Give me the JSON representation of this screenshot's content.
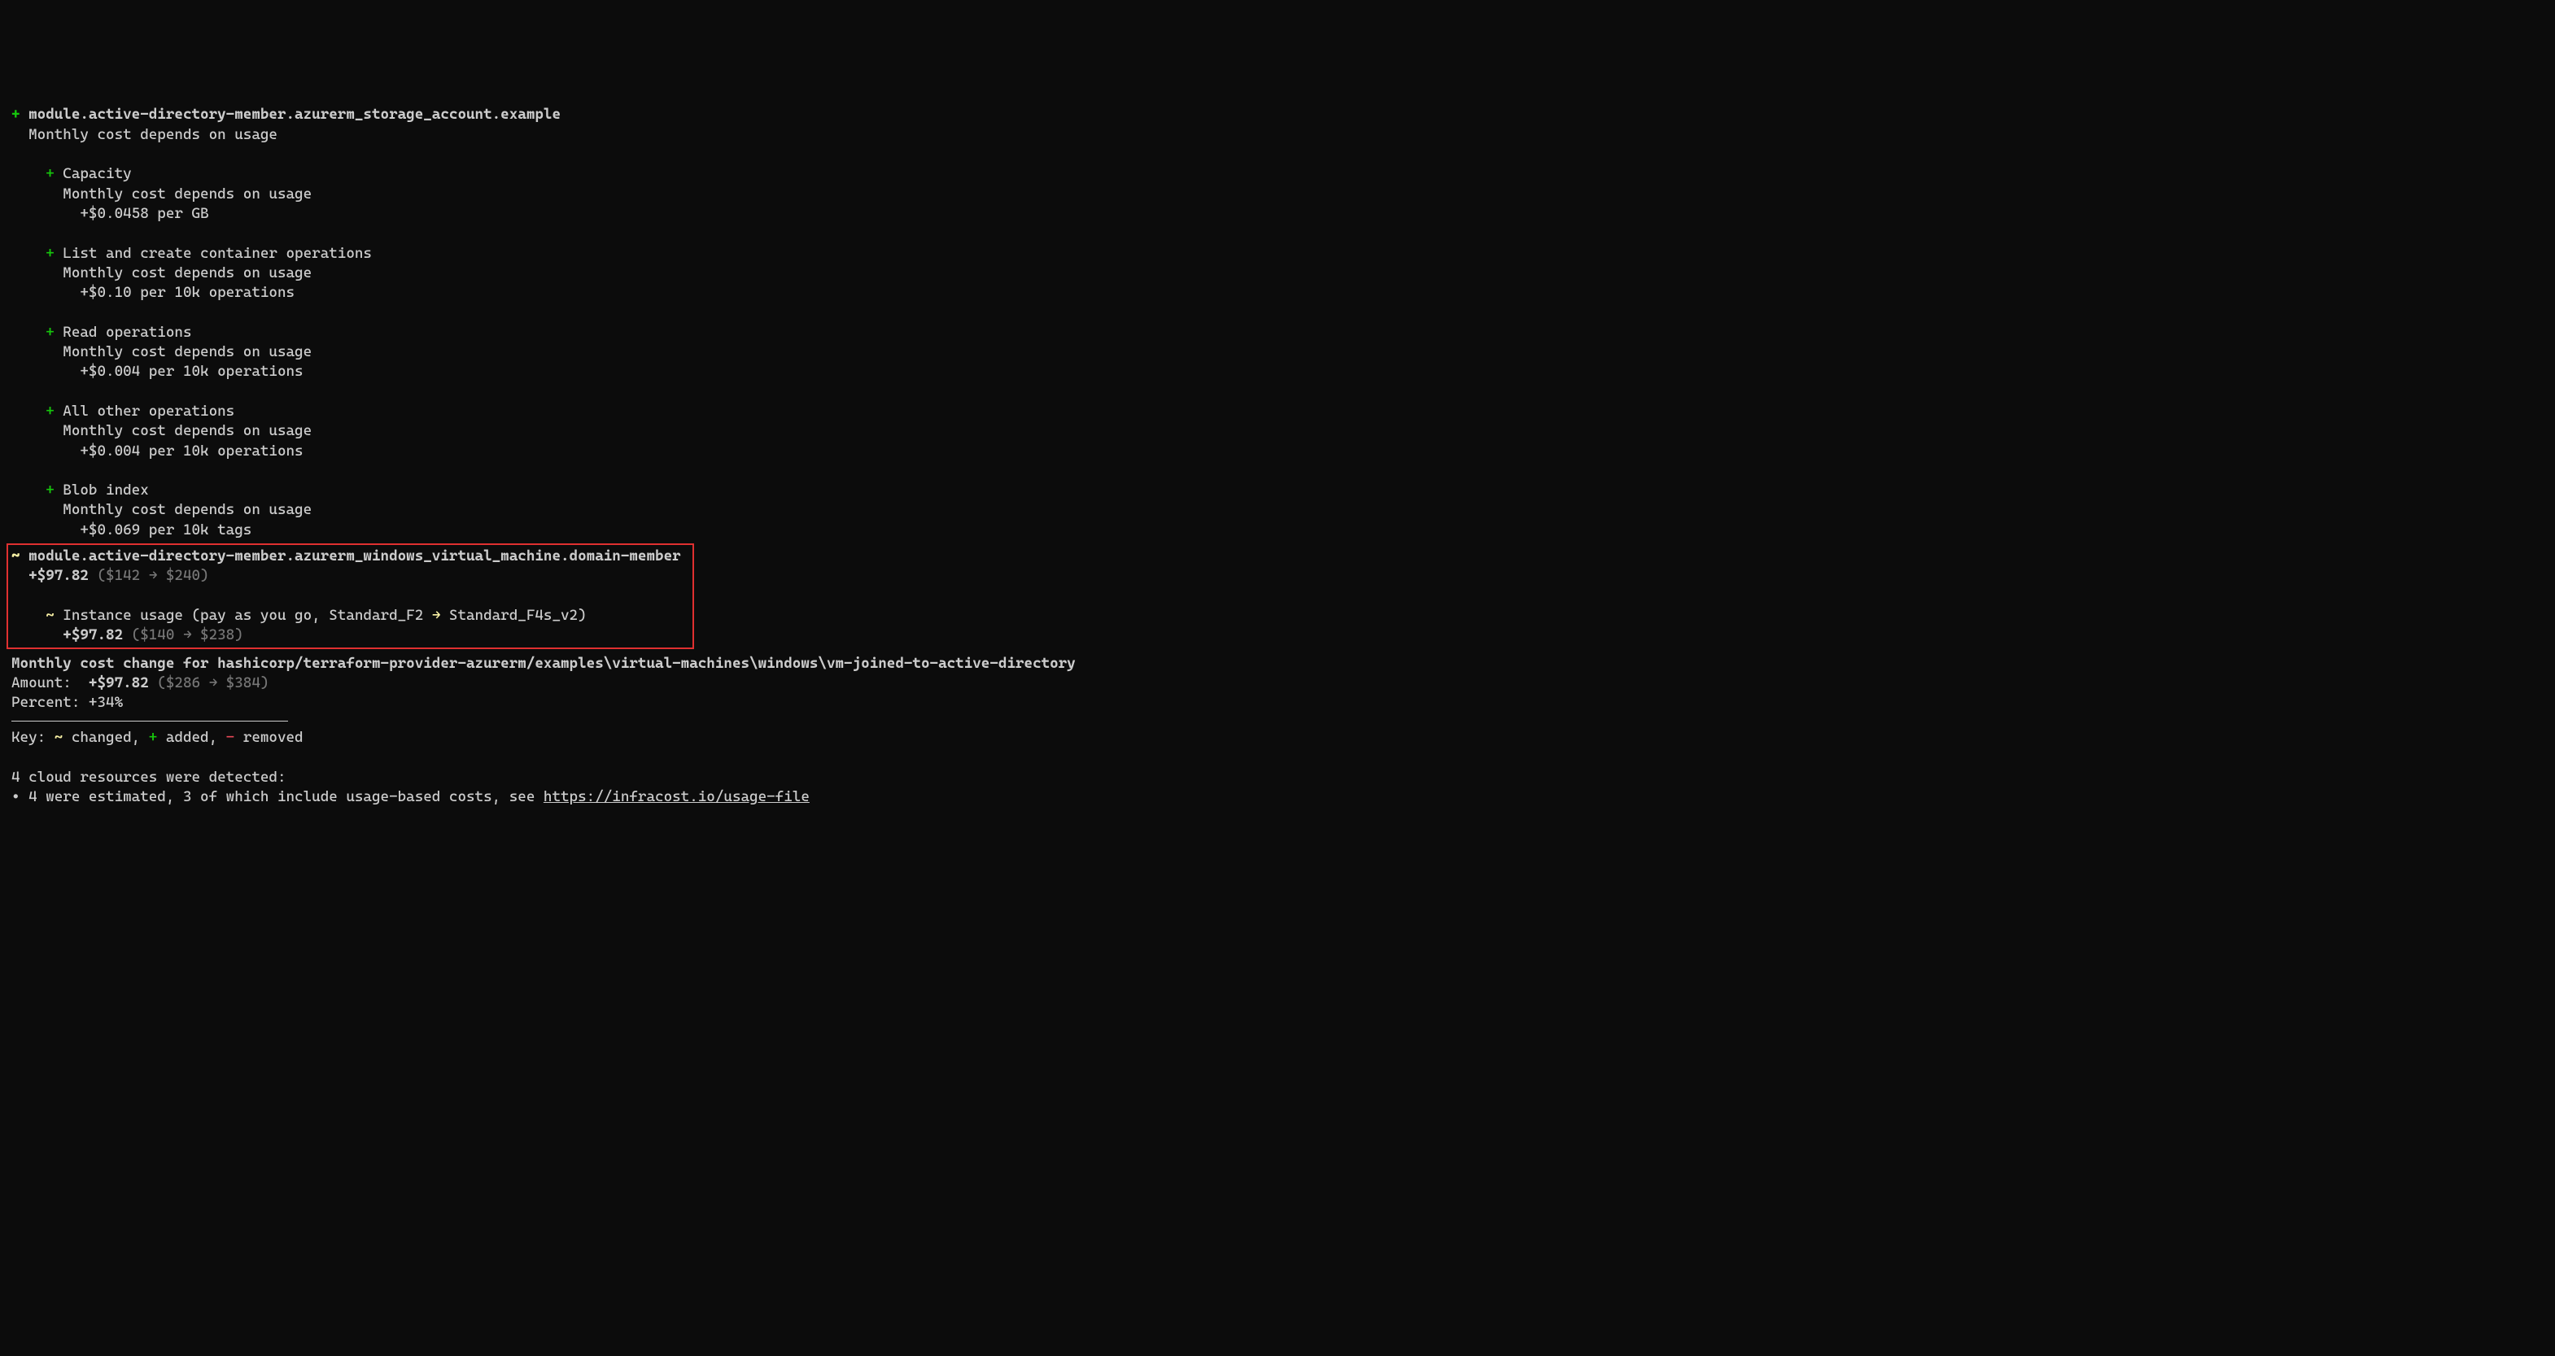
{
  "resource1": {
    "sign": "+",
    "path": "module.active-directory-member.azurerm_storage_account.example",
    "cost_line": "Monthly cost depends on usage",
    "items": [
      {
        "sign": "+",
        "name": "Capacity",
        "desc": "Monthly cost depends on usage",
        "rate": "+$0.0458 per GB"
      },
      {
        "sign": "+",
        "name": "List and create container operations",
        "desc": "Monthly cost depends on usage",
        "rate": "+$0.10 per 10k operations"
      },
      {
        "sign": "+",
        "name": "Read operations",
        "desc": "Monthly cost depends on usage",
        "rate": "+$0.004 per 10k operations"
      },
      {
        "sign": "+",
        "name": "All other operations",
        "desc": "Monthly cost depends on usage",
        "rate": "+$0.004 per 10k operations"
      },
      {
        "sign": "+",
        "name": "Blob index",
        "desc": "Monthly cost depends on usage",
        "rate": "+$0.069 per 10k tags"
      }
    ]
  },
  "resource2": {
    "sign": "~",
    "path": "module.active-directory-member.azurerm_windows_virtual_machine.domain-member",
    "delta": "+$97.82",
    "from": "$142",
    "arrow": "→",
    "to": "$240",
    "sub": {
      "sign": "~",
      "prefix": "Instance usage (pay as you go, ",
      "from_tier": "Standard_F2",
      "arrow": "→",
      "to_tier": "Standard_F4s_v2",
      "suffix": ")",
      "delta": "+$97.82",
      "from": "$140",
      "to": "$238"
    }
  },
  "summary": {
    "line1": "Monthly cost change for hashicorp/terraform-provider-azurerm/examples\\virtual-machines\\windows\\vm-joined-to-active-directory",
    "amount_label": "Amount:",
    "amount_delta": "+$97.82",
    "amount_from": "$286",
    "amount_arrow": "→",
    "amount_to": "$384",
    "percent_label": "Percent:",
    "percent_value": "+34%"
  },
  "key": {
    "prefix": "Key:",
    "changed_sign": "~",
    "changed_label": "changed,",
    "added_sign": "+",
    "added_label": "added,",
    "removed_sign": "-",
    "removed_label": "removed"
  },
  "footer": {
    "line1": "4 cloud resources were detected:",
    "bullet": "∙",
    "line2a": "4 were estimated, 3 of which include usage-based costs, see ",
    "link": "https://infracost.io/usage-file"
  }
}
